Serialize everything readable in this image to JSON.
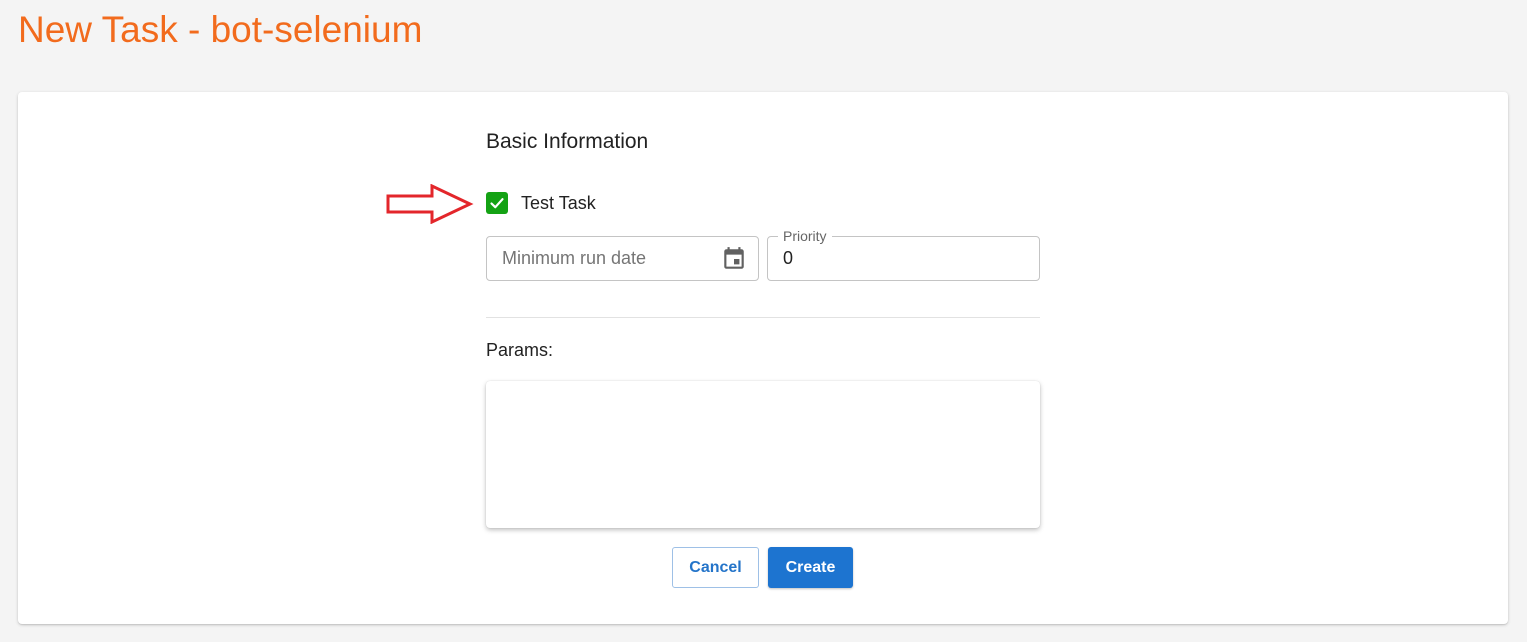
{
  "page": {
    "title": "New Task - bot-selenium"
  },
  "form": {
    "section_title": "Basic Information",
    "test_task": {
      "label": "Test Task",
      "checked": true,
      "icon": "check-icon"
    },
    "min_run_date": {
      "placeholder": "Minimum run date",
      "value": "",
      "icon": "calendar-icon"
    },
    "priority": {
      "label": "Priority",
      "value": "0"
    },
    "params": {
      "label": "Params:",
      "value": ""
    },
    "buttons": {
      "cancel_label": "Cancel",
      "create_label": "Create"
    }
  },
  "annotation": {
    "icon": "arrow-right-icon",
    "color": "#e3262b"
  },
  "colors": {
    "title": "#f26b1d",
    "checkbox": "#14a214",
    "primary": "#1d74d0",
    "background": "#f4f4f4"
  }
}
